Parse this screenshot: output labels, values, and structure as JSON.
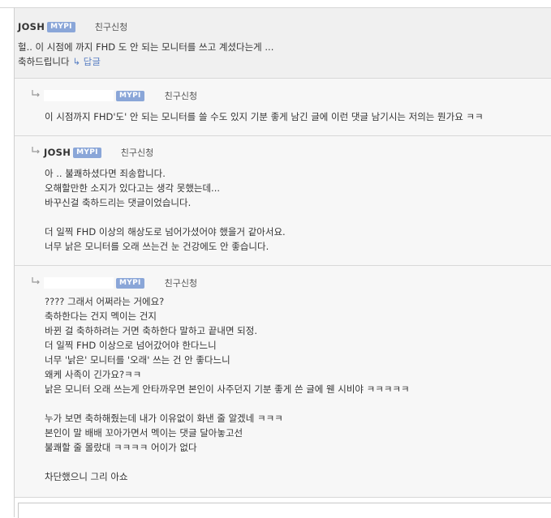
{
  "main_comment": {
    "nickname": "JOSH",
    "badge": "MYPI",
    "friend_request": "친구신청",
    "lines": [
      "헐.. 이 시점에 까지 FHD 도 안 되는 모니터를 쓰고 계셨다는게 ...",
      "축하드립니다"
    ],
    "reply_label": "답글"
  },
  "replies": [
    {
      "nickname": "",
      "badge": "MYPI",
      "friend_request": "친구신청",
      "lines": [
        "이 시점까지 FHD'도' 안 되는 모니터를 쓸 수도 있지 기분 좋게 남긴 글에 이런 댓글 남기시는 저의는 뭔가요 ㅋㅋ"
      ]
    },
    {
      "nickname": "JOSH",
      "badge": "MYPI",
      "friend_request": "친구신청",
      "lines": [
        "아 .. 불쾌하셨다면 죄송합니다.",
        "오해할만한 소지가 있다고는 생각 못했는데...",
        "바꾸신걸 축하드리는 댓글이었습니다.",
        "",
        "더 일찍 FHD 이상의 해상도로 넘어가셨어야 했을거 같아서요.",
        "너무 낡은 모니터를 오래 쓰는건 눈 건강에도 안 좋습니다."
      ]
    },
    {
      "nickname": "",
      "badge": "MYPI",
      "friend_request": "친구신청",
      "lines": [
        "???? 그래서 어쩌라는 거에요?",
        "축하한다는 건지 멕이는 건지",
        "바뀐 걸 축하하려는 거면 축하한다 말하고 끝내면 되정.",
        "더 일찍 FHD 이상으로 넘어갔어야 한다느니",
        "너무 '낡은' 모니터를 '오래' 쓰는 건 안 좋다느니",
        "왜케 사족이 긴가요?ㅋㅋ",
        "낡은 모니터 오래 쓰는게 안타까우면 본인이 사주던지 기분 좋게 쓴 글에 웬 시비야 ㅋㅋㅋㅋㅋ",
        "",
        "누가 보면 축하해줬는데 내가 이유없이 화낸 줄 알겠네 ㅋㅋㅋ",
        "본인이 말 배배 꼬아가면서 멕이는 댓글 달아놓고선",
        "불쾌할 줄 몰랐대 ㅋㅋㅋㅋ 어이가 없다",
        "",
        "차단했으니 그리 아쇼"
      ]
    }
  ],
  "colors": {
    "badge_bg": "#8aa6d8",
    "reply_link": "#5a80c4",
    "main_bg": "#f0f0f0",
    "reply_bg": "#f7f7f7"
  },
  "icons": {
    "reply_arrow": "reply-arrow-icon"
  }
}
